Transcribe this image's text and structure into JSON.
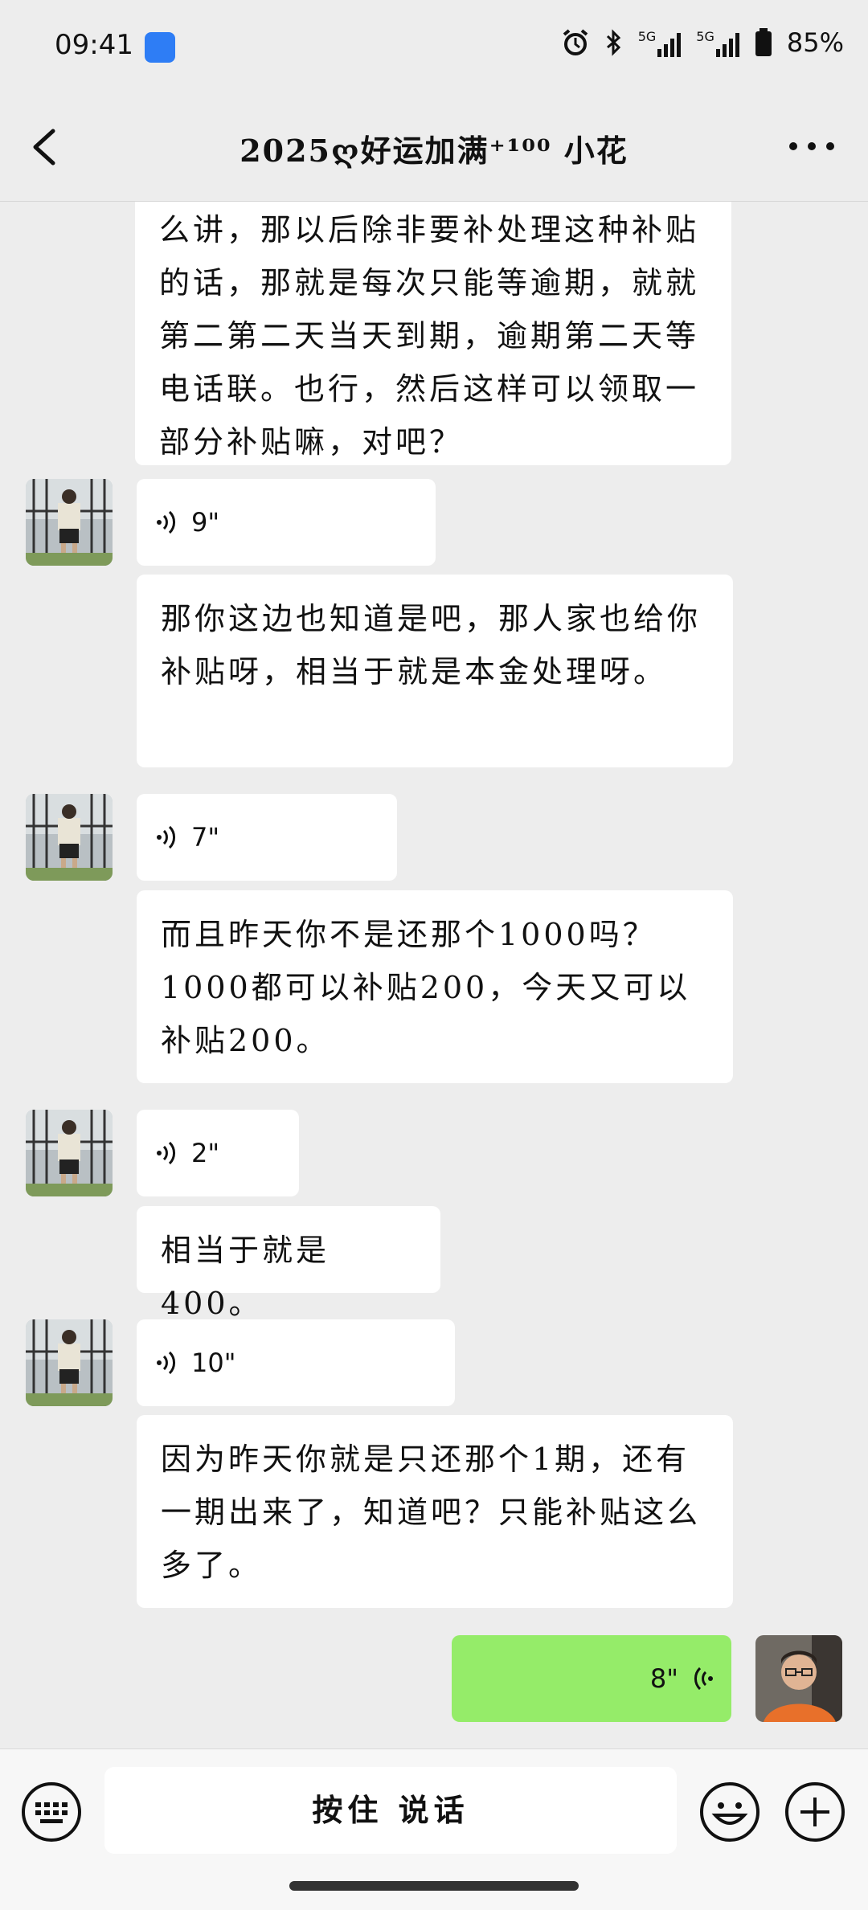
{
  "status_bar": {
    "time": "09:41",
    "network_1": "5G",
    "network_2": "5G",
    "battery": "85%"
  },
  "header": {
    "title": "2025ღ好运加满⁺¹⁰⁰ 小花",
    "back_icon": "chevron-left-icon",
    "more_icon": "ellipsis-icon"
  },
  "messages": [
    {
      "type": "text",
      "side": "left",
      "text": "么讲，那以后除非要补处理这种补贴的话，那就是每次只能等逾期，就就第二第二天当天到期，逾期第二天等电话联。也行，然后这样可以领取一部分补贴嘛，对吧？"
    },
    {
      "type": "voice",
      "side": "left",
      "duration": "9\""
    },
    {
      "type": "text",
      "side": "left",
      "text": "那你这边也知道是吧，那人家也给你补贴呀，相当于就是本金处理呀。"
    },
    {
      "type": "voice",
      "side": "left",
      "duration": "7\""
    },
    {
      "type": "text",
      "side": "left",
      "text": "而且昨天你不是还那个1000吗？1000都可以补贴200，今天又可以补贴200。"
    },
    {
      "type": "voice",
      "side": "left",
      "duration": "2\""
    },
    {
      "type": "text",
      "side": "left",
      "text": "相当于就是400。"
    },
    {
      "type": "voice",
      "side": "left",
      "duration": "10\""
    },
    {
      "type": "text",
      "side": "left",
      "text": "因为昨天你就是只还那个1期，还有一期出来了，知道吧？只能补贴这么多了。"
    },
    {
      "type": "voice",
      "side": "right",
      "duration": "8\""
    }
  ],
  "input_bar": {
    "talk_label": "按住 说话",
    "keyboard_icon": "keyboard-icon",
    "emoji_icon": "emoji-icon",
    "plus_icon": "plus-icon"
  },
  "colors": {
    "background": "#ededed",
    "bubble_other": "#ffffff",
    "bubble_self": "#95ec69"
  }
}
